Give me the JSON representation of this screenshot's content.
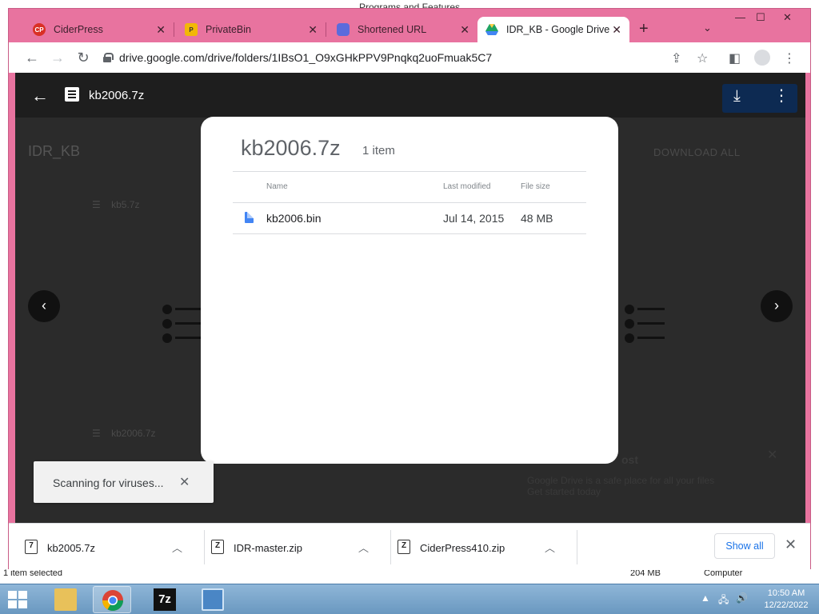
{
  "background_window": {
    "title": "Programs and Features",
    "status_left": "1 item selected",
    "status_mid": "204 MB",
    "status_right": "Computer"
  },
  "browser": {
    "tabs": [
      {
        "label": "CiderPress",
        "icon": "ciderpress-icon",
        "color": "#d93025",
        "active": false
      },
      {
        "label": "PrivateBin",
        "icon": "privatebin-icon",
        "color": "#f2b807",
        "active": false
      },
      {
        "label": "Shortened URL",
        "icon": "shortened-url-icon",
        "color": "#5b6bdc",
        "active": false
      },
      {
        "label": "IDR_KB - Google Drive",
        "icon": "google-drive-icon",
        "color": "#1fa463",
        "active": true
      }
    ],
    "url": "drive.google.com/drive/folders/1IBsO1_O9xGHkPPV9Pnqkq2uoFmuak5C7"
  },
  "viewer": {
    "title": "kb2006.7z",
    "folder": "IDR_KB",
    "download_all": "DOWNLOAD ALL",
    "ghost_items": [
      "kb5.7z",
      "kb2006.7z"
    ],
    "promo_title": "ost",
    "promo_text_1": "Google Drive is a safe place for all your files",
    "promo_text_2": "Get started today"
  },
  "modal": {
    "title": "kb2006.7z",
    "count": "1 item",
    "columns": {
      "name": "Name",
      "modified": "Last modified",
      "size": "File size"
    },
    "rows": [
      {
        "name": "kb2006.bin",
        "modified": "Jul 14, 2015",
        "size": "48 MB"
      }
    ]
  },
  "toast": {
    "text": "Scanning for viruses..."
  },
  "downloads": {
    "items": [
      {
        "name": "kb2005.7z"
      },
      {
        "name": "IDR-master.zip"
      },
      {
        "name": "CiderPress410.zip"
      }
    ],
    "show_all": "Show all"
  },
  "taskbar": {
    "time": "10:50 AM",
    "date": "12/22/2022"
  },
  "colors": {
    "chrome_frame": "#e8739f",
    "viewer_bg": "#2b2b2b",
    "download_btn": "#0d2a52",
    "link_blue": "#1a73e8"
  }
}
